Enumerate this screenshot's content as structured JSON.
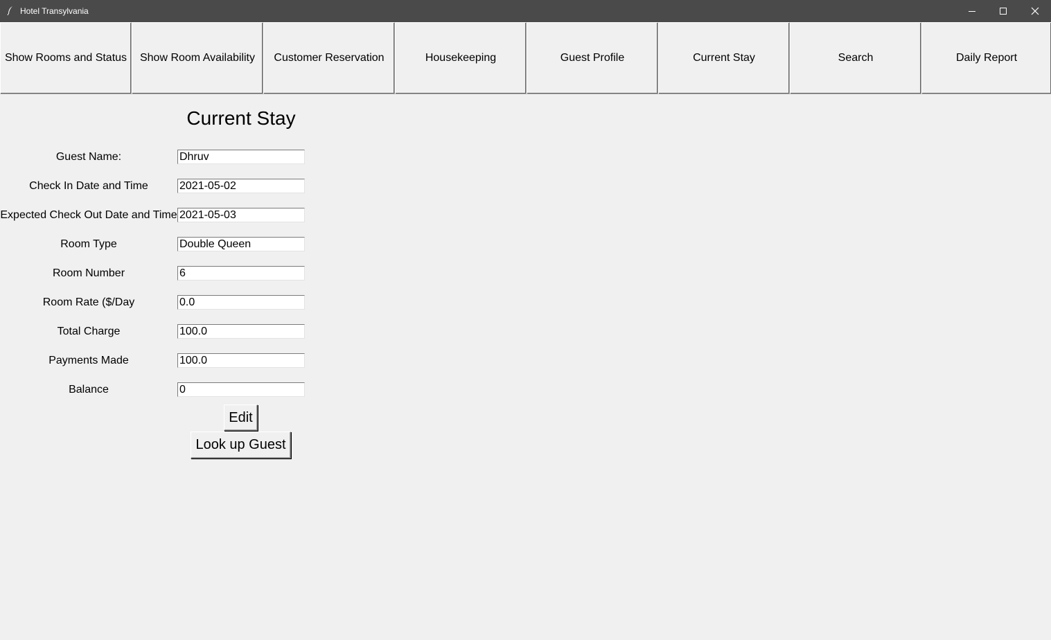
{
  "window": {
    "title": "Hotel Transylvania",
    "icons": {
      "app": "feather-icon",
      "minimize": "minimize-icon",
      "maximize": "maximize-icon",
      "close": "close-icon"
    }
  },
  "nav": {
    "tabs": [
      {
        "label": "Show Rooms and Status"
      },
      {
        "label": "Show Room Availability"
      },
      {
        "label": "Customer Reservation"
      },
      {
        "label": "Housekeeping"
      },
      {
        "label": "Guest Profile"
      },
      {
        "label": "Current Stay"
      },
      {
        "label": "Search"
      },
      {
        "label": "Daily Report"
      }
    ]
  },
  "page": {
    "heading": "Current Stay",
    "fields": [
      {
        "label": "Guest Name:",
        "value": "Dhruv"
      },
      {
        "label": "Check In Date and Time",
        "value": "2021-05-02"
      },
      {
        "label": "Expected Check Out Date and Time",
        "value": "2021-05-03"
      },
      {
        "label": "Room Type",
        "value": "Double Queen"
      },
      {
        "label": "Room Number",
        "value": "6"
      },
      {
        "label": "Room Rate ($/Day",
        "value": "0.0"
      },
      {
        "label": "Total Charge",
        "value": "100.0"
      },
      {
        "label": "Payments Made",
        "value": "100.0"
      },
      {
        "label": "Balance",
        "value": "0"
      }
    ],
    "buttons": {
      "edit": "Edit",
      "lookup": "Look up Guest"
    }
  }
}
